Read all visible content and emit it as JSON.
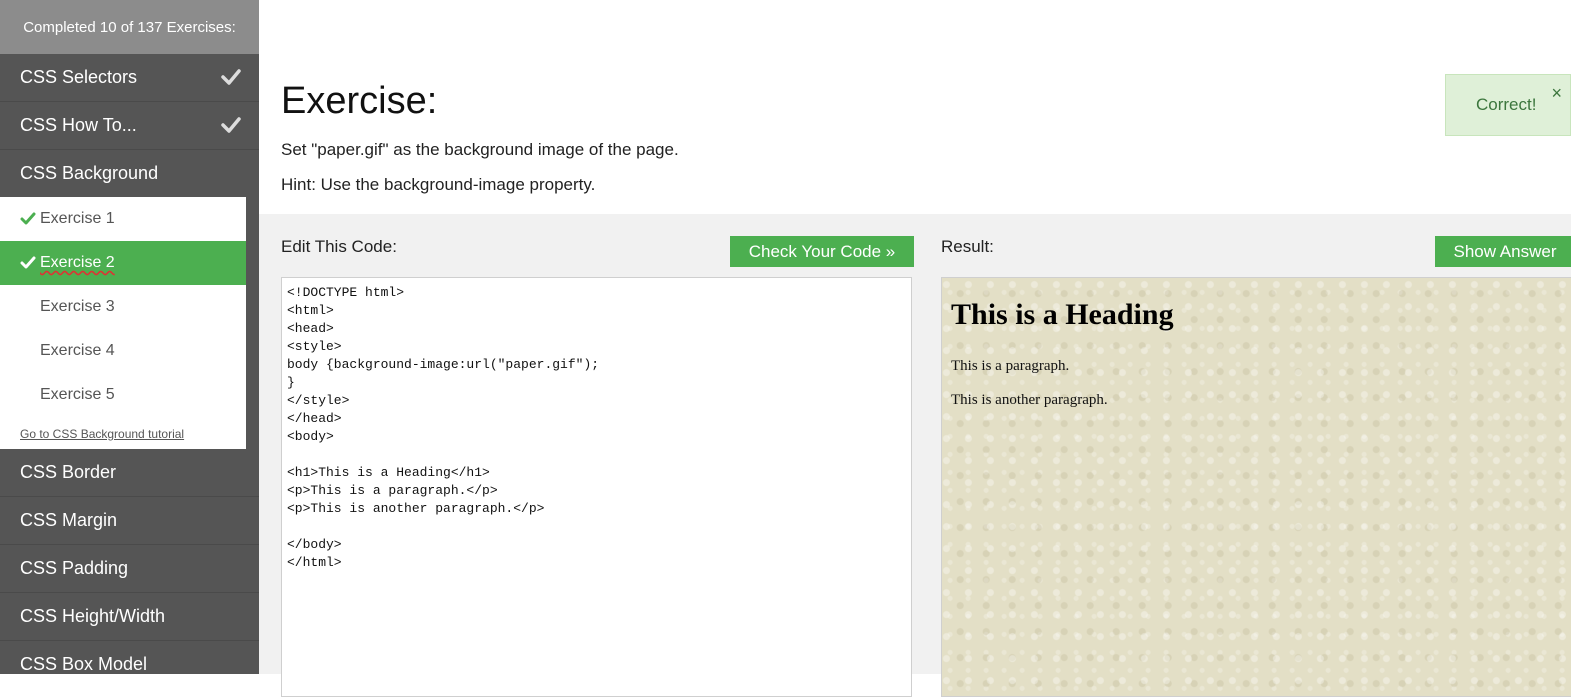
{
  "sidebar": {
    "progress": "Completed 10 of 137 Exercises:",
    "categories_top": [
      {
        "label": "CSS Selectors",
        "checked": true
      },
      {
        "label": "CSS How To...",
        "checked": true
      },
      {
        "label": "CSS Background",
        "checked": false
      }
    ],
    "exercises": [
      {
        "label": "Exercise 1",
        "done": true
      },
      {
        "label": "Exercise 2",
        "done": true
      },
      {
        "label": "Exercise 3",
        "done": false
      },
      {
        "label": "Exercise 4",
        "done": false
      },
      {
        "label": "Exercise 5",
        "done": false
      }
    ],
    "tutorial_link": "Go to CSS Background tutorial",
    "categories_bottom": [
      {
        "label": "CSS Border"
      },
      {
        "label": "CSS Margin"
      },
      {
        "label": "CSS Padding"
      },
      {
        "label": "CSS Height/Width"
      },
      {
        "label": "CSS Box Model"
      }
    ]
  },
  "exercise": {
    "title": "Exercise:",
    "instruction": "Set \"paper.gif\" as the background image of the page.",
    "hint": "Hint: Use the background-image property."
  },
  "notification": {
    "text": "Correct!",
    "close_symbol": "×"
  },
  "editor": {
    "label": "Edit This Code:",
    "check_button": "Check Your Code »",
    "code": "<!DOCTYPE html>\n<html>\n<head>\n<style>\nbody {background-image:url(\"paper.gif\");\n}\n</style>\n</head>\n<body>\n\n<h1>This is a Heading</h1>\n<p>This is a paragraph.</p>\n<p>This is another paragraph.</p>\n\n</body>\n</html>"
  },
  "result": {
    "label": "Result:",
    "answer_button": "Show Answer",
    "heading": "This is a Heading",
    "paragraph1": "This is a paragraph.",
    "paragraph2": "This is another paragraph."
  },
  "colors": {
    "accent_green": "#4caf50",
    "sidebar_bg": "#555555",
    "progress_bg": "#8c8c8c",
    "alert_bg": "#dff0d8"
  }
}
